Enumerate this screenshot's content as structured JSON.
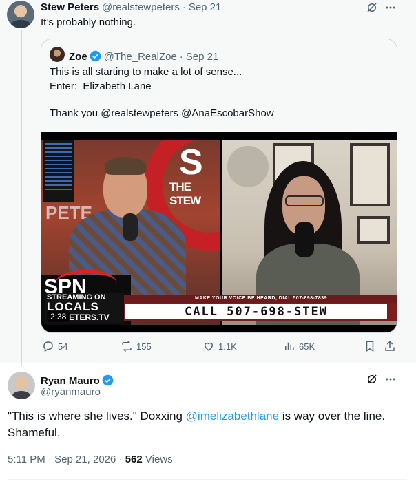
{
  "parent_tweet": {
    "author_name": "Stew Peters",
    "handle": "@realstewpeters",
    "separator": "·",
    "date": "Sep 21",
    "text": "It’s probably nothing.",
    "grok_icon": "grok-icon",
    "more_icon": "more-icon"
  },
  "quote": {
    "author_name": "Zoe",
    "handle": "@The_RealZoe",
    "separator": "·",
    "date": "Sep 21",
    "line1": "This is all starting to make a lot of sense...",
    "line2": "Enter:  Elizabeth Lane",
    "line3": "Thank you @realstewpeters @AnaEscobarShow",
    "video": {
      "big_s": "S",
      "the_stew": "THE STEW",
      "peters_wall": "PETE",
      "spn_logo": "SPN",
      "streaming_on": "STREAMING ON",
      "locals": "LOCALS",
      "site": "ETERS.TV",
      "banner_top": "MAKE YOUR VOICE BE HEARD, DIAL 507-698-7839",
      "banner_main": "CALL  507-698-STEW",
      "timestamp": "2:38"
    }
  },
  "actions": {
    "replies": "54",
    "reposts": "155",
    "likes": "1.1K",
    "views": "65K"
  },
  "main_tweet": {
    "author_name": "Ryan Mauro",
    "handle": "@ryanmauro",
    "text_before": "\"This is where she lives.\" Doxxing ",
    "mention": "@imelizabethlane",
    "text_after": " is way over the line. Shameful.",
    "time": "5:11 PM",
    "separator": "·",
    "date": "Sep 21, 2026",
    "separator2": "·",
    "views_count": "562",
    "views_label": "Views"
  },
  "colors": {
    "accent": "#1d9bf0",
    "secondary_text": "#536471",
    "primary_text": "#0f1419",
    "thread_bg": "#f7f9f9"
  }
}
